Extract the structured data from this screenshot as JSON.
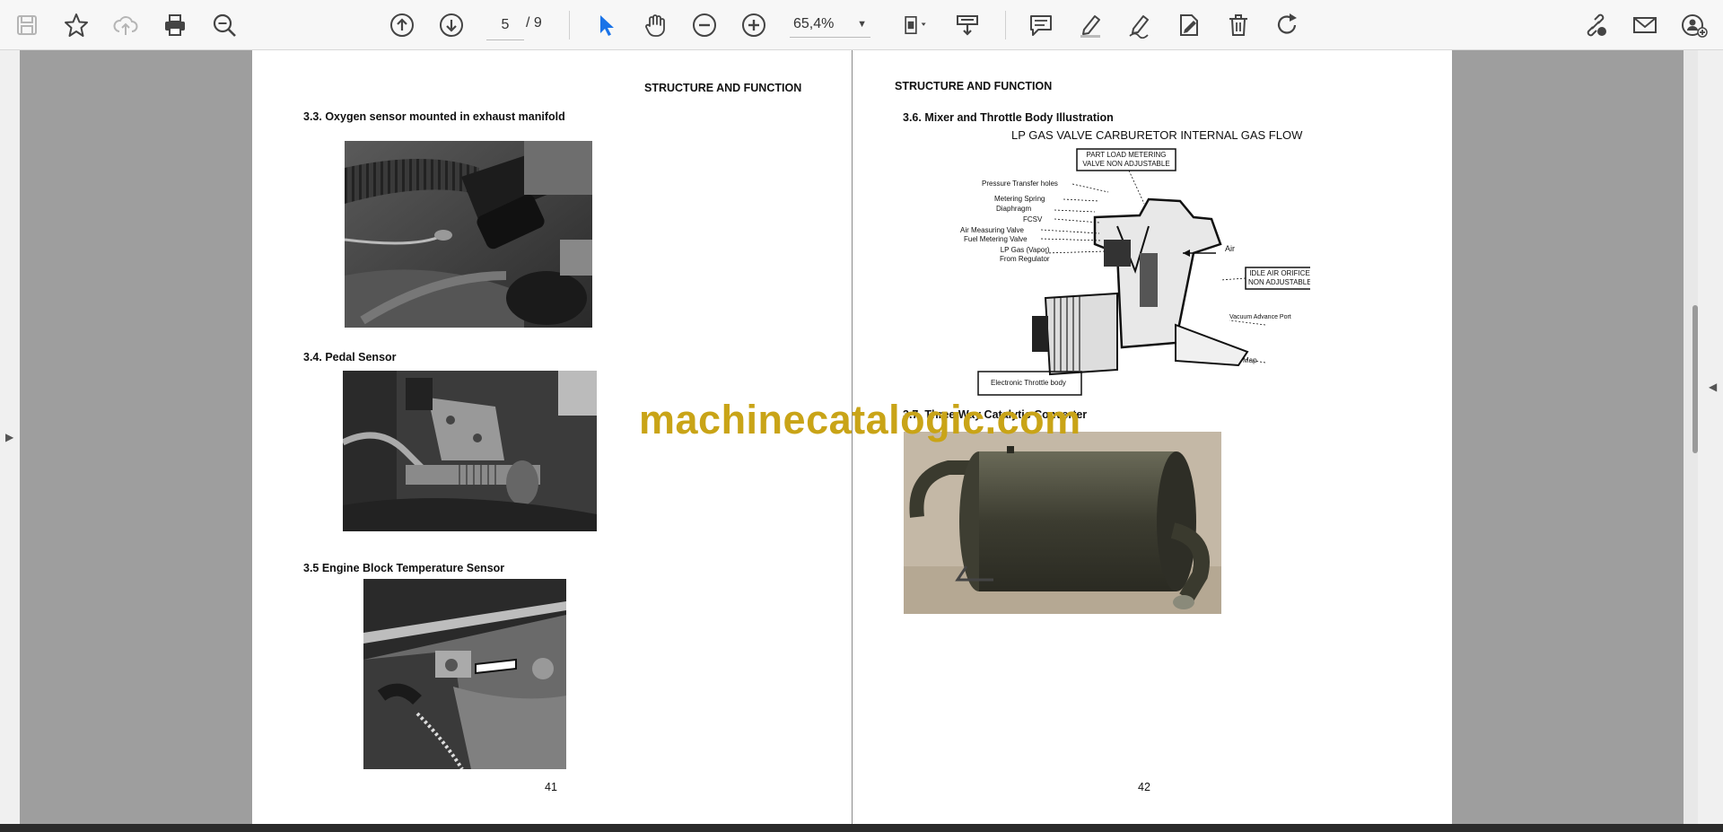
{
  "toolbar": {
    "page_current": "5",
    "page_total": "/ 9",
    "zoom": "65,4%"
  },
  "page_left": {
    "header": "STRUCTURE AND FUNCTION",
    "section1": "3.3. Oxygen sensor mounted in exhaust manifold",
    "section2": "3.4.  Pedal Sensor",
    "section3": "3.5  Engine Block Temperature Sensor",
    "page_number": "41"
  },
  "page_right": {
    "header": "STRUCTURE AND FUNCTION",
    "section1": "3.6. Mixer and Throttle Body Illustration",
    "diagram_title": "LP GAS VALVE CARBURETOR INTERNAL GAS FLOW",
    "labels": {
      "part_load": "PART LOAD METERING",
      "valve_non": "VALVE NON ADJUSTABLE",
      "pressure": "Pressure Transfer holes",
      "metering_spring": "Metering Spring",
      "diaphragm": "Diaphragm",
      "fcsv": "FCSV",
      "air_measuring": "Air Measuring Valve",
      "fuel_metering": "Fuel Metering Valve",
      "lp_gas": "LP Gas (Vapor)",
      "from_regulator": "From Regulator",
      "air": "Air",
      "idle_air": "IDLE AIR ORIFICE",
      "non_adjustable": "NON ADJUSTABLE",
      "vacuum": "Vacuum Advance Port",
      "map": "Map",
      "electronic": "Electronic Throttle body"
    },
    "section2": "3.7. Three Way Catalytic Converter",
    "page_number": "42"
  },
  "watermark": "machinecatalogic.com"
}
